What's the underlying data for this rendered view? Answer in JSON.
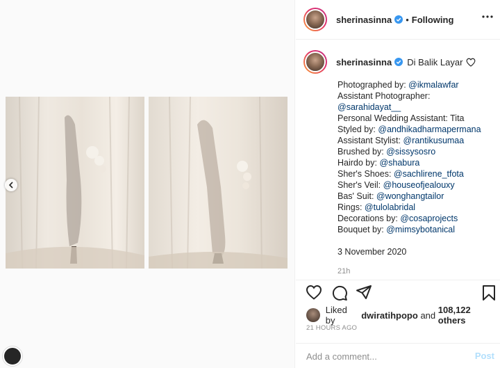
{
  "post": {
    "username": "sherinasinna",
    "follow_status": "Following",
    "separator": "•"
  },
  "caption": {
    "username": "sherinasinna",
    "title": "Di Balik Layar",
    "lines": [
      {
        "label": "Photographed by: ",
        "mention": "@ikmalawfar"
      },
      {
        "label": "Assistant Photographer:",
        "mention": ""
      },
      {
        "label": "",
        "mention": "@sarahidayat__"
      },
      {
        "label": "Personal Wedding Assistant: Tita",
        "mention": ""
      },
      {
        "label": "Styled by: ",
        "mention": "@andhikadharmapermana"
      },
      {
        "label": "Assistant Stylist: ",
        "mention": "@rantikusumaa"
      },
      {
        "label": "Brushed by: ",
        "mention": "@sissysosro"
      },
      {
        "label": "Hairdo by: ",
        "mention": "@shabura"
      },
      {
        "label": "Sher's Shoes: ",
        "mention": "@sachlirene_tfota"
      },
      {
        "label": "Sher's Veil: ",
        "mention": "@houseofjealouxy"
      },
      {
        "label": "Bas' Suit: ",
        "mention": "@wonghangtailor"
      },
      {
        "label": "Rings: ",
        "mention": "@tulolabridal"
      },
      {
        "label": "Decorations by: ",
        "mention": "@cosaprojects"
      },
      {
        "label": "Bouquet by: ",
        "mention": "@mimsybotanical"
      }
    ],
    "date": "3 November 2020",
    "age": "21h"
  },
  "likes": {
    "prefix": "Liked by ",
    "user": "dwiratihpopo",
    "middle": " and ",
    "count": "108,122 others"
  },
  "timestamp": "21 HOURS AGO",
  "comment": {
    "placeholder": "Add a comment...",
    "post_label": "Post"
  },
  "icons": {
    "verified": "verified-badge-icon",
    "more": "more-options-icon",
    "like": "heart-icon",
    "comment": "comment-icon",
    "share": "share-icon",
    "save": "bookmark-icon",
    "prev": "chevron-left-icon"
  },
  "colors": {
    "link": "#00376b",
    "verified": "#3897f0",
    "post_disabled": "#b2dffc",
    "muted": "#8e8e8e"
  }
}
